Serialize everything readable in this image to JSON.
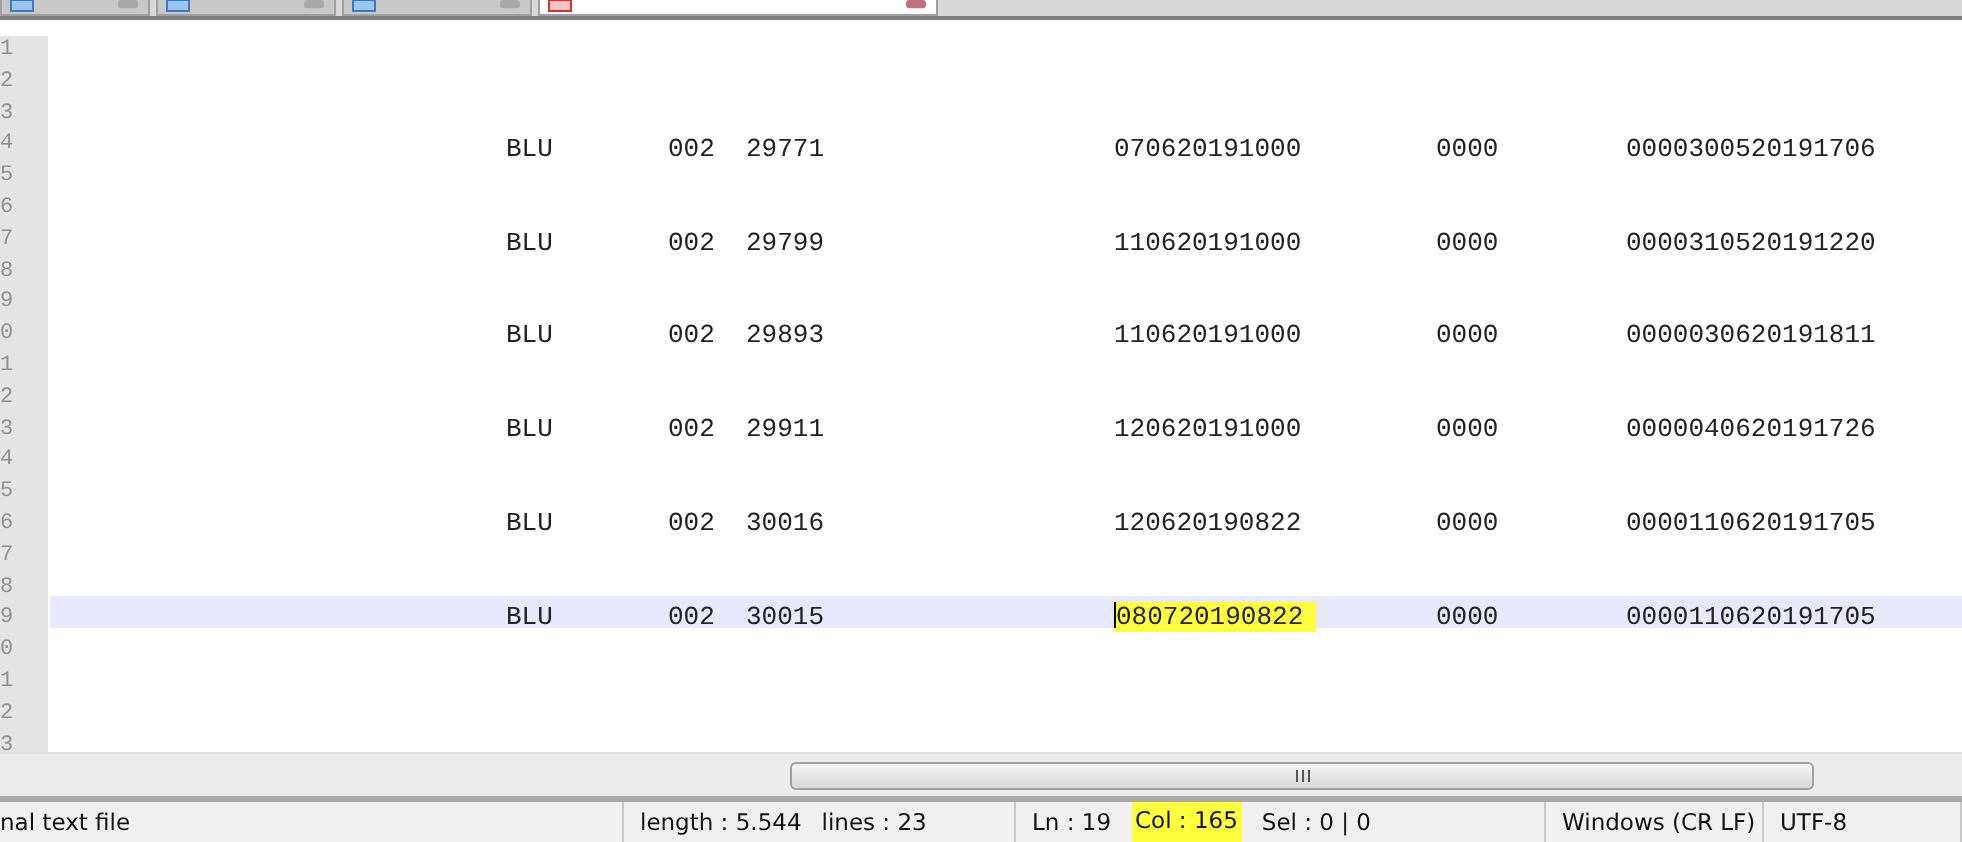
{
  "tabs": [
    {
      "selected": false
    },
    {
      "selected": false
    },
    {
      "selected": false
    },
    {
      "selected": true
    }
  ],
  "lines": [
    {
      "number": "1",
      "current": false
    },
    {
      "number": "2",
      "current": false
    },
    {
      "number": "3",
      "current": false
    },
    {
      "number": "4",
      "current": false,
      "cells": [
        {
          "text": "BLU",
          "highlighted": false,
          "caret": false
        },
        {
          "text": "002",
          "highlighted": false,
          "caret": false
        },
        {
          "text": "29771",
          "highlighted": false,
          "caret": false
        },
        {
          "text": "070620191000",
          "highlighted": false,
          "caret": false
        },
        {
          "text": "0000",
          "highlighted": false,
          "caret": false
        },
        {
          "text": "0000300520191706",
          "highlighted": false,
          "caret": false
        }
      ]
    },
    {
      "number": "5",
      "current": false
    },
    {
      "number": "6",
      "current": false
    },
    {
      "number": "7",
      "current": false,
      "cells": [
        {
          "text": "BLU",
          "highlighted": false,
          "caret": false
        },
        {
          "text": "002",
          "highlighted": false,
          "caret": false
        },
        {
          "text": "29799",
          "highlighted": false,
          "caret": false
        },
        {
          "text": "110620191000",
          "highlighted": false,
          "caret": false
        },
        {
          "text": "0000",
          "highlighted": false,
          "caret": false
        },
        {
          "text": "0000310520191220",
          "highlighted": false,
          "caret": false
        }
      ]
    },
    {
      "number": "8",
      "current": false
    },
    {
      "number": "9",
      "current": false
    },
    {
      "number": "0",
      "current": false,
      "cells": [
        {
          "text": "BLU",
          "highlighted": false,
          "caret": false
        },
        {
          "text": "002",
          "highlighted": false,
          "caret": false
        },
        {
          "text": "29893",
          "highlighted": false,
          "caret": false
        },
        {
          "text": "110620191000",
          "highlighted": false,
          "caret": false
        },
        {
          "text": "0000",
          "highlighted": false,
          "caret": false
        },
        {
          "text": "0000030620191811",
          "highlighted": false,
          "caret": false
        }
      ]
    },
    {
      "number": "1",
      "current": false
    },
    {
      "number": "2",
      "current": false
    },
    {
      "number": "3",
      "current": false,
      "cells": [
        {
          "text": "BLU",
          "highlighted": false,
          "caret": false
        },
        {
          "text": "002",
          "highlighted": false,
          "caret": false
        },
        {
          "text": "29911",
          "highlighted": false,
          "caret": false
        },
        {
          "text": "120620191000",
          "highlighted": false,
          "caret": false
        },
        {
          "text": "0000",
          "highlighted": false,
          "caret": false
        },
        {
          "text": "0000040620191726",
          "highlighted": false,
          "caret": false
        }
      ]
    },
    {
      "number": "4",
      "current": false
    },
    {
      "number": "5",
      "current": false
    },
    {
      "number": "6",
      "current": false,
      "cells": [
        {
          "text": "BLU",
          "highlighted": false,
          "caret": false
        },
        {
          "text": "002",
          "highlighted": false,
          "caret": false
        },
        {
          "text": "30016",
          "highlighted": false,
          "caret": false
        },
        {
          "text": "120620190822",
          "highlighted": false,
          "caret": false
        },
        {
          "text": "0000",
          "highlighted": false,
          "caret": false
        },
        {
          "text": "0000110620191705",
          "highlighted": false,
          "caret": false
        }
      ]
    },
    {
      "number": "7",
      "current": false
    },
    {
      "number": "8",
      "current": false
    },
    {
      "number": "9",
      "current": true,
      "cells": [
        {
          "text": "BLU",
          "highlighted": false,
          "caret": false
        },
        {
          "text": "002",
          "highlighted": false,
          "caret": false
        },
        {
          "text": "30015",
          "highlighted": false,
          "caret": false
        },
        {
          "text": "080720190822",
          "highlighted": true,
          "caret": true
        },
        {
          "text": "0000",
          "highlighted": false,
          "caret": false
        },
        {
          "text": "0000110620191705",
          "highlighted": false,
          "caret": false
        }
      ]
    },
    {
      "number": "0",
      "current": false
    },
    {
      "number": "1",
      "current": false
    },
    {
      "number": "2",
      "current": false
    },
    {
      "number": "3",
      "current": false
    }
  ],
  "status_bar": [
    {
      "text": "nal text file",
      "highlighted": false
    },
    {
      "text": "length : 5.544",
      "highlighted": false
    },
    {
      "text": "lines : 23",
      "highlighted": false
    },
    {
      "text": "Ln : 19",
      "highlighted": false
    },
    {
      "text": "Col : 165",
      "highlighted": true
    },
    {
      "text": "Sel : 0 | 0",
      "highlighted": false
    },
    {
      "text": "Windows (CR LF)",
      "highlighted": false
    },
    {
      "text": "UTF-8",
      "highlighted": false
    }
  ]
}
